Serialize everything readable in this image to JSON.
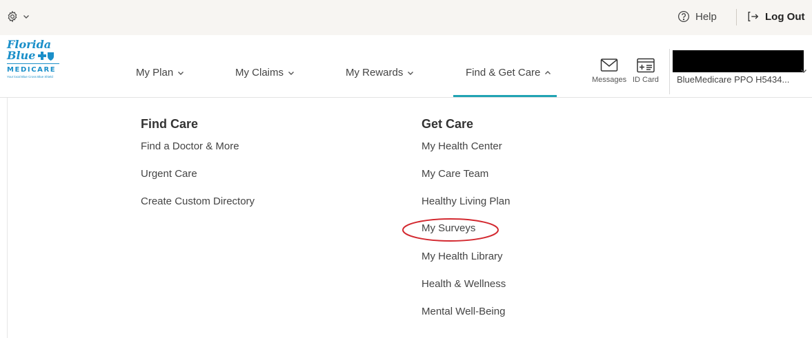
{
  "utility": {
    "settings_icon": "gear-icon",
    "help_label": "Help",
    "logout_label": "Log Out"
  },
  "logo": {
    "line1": "Florida",
    "line2": "Blue",
    "medicare": "MEDICARE",
    "tagline": "Your local Blue Cross Blue Shield"
  },
  "nav": {
    "items": [
      {
        "label": "My Plan"
      },
      {
        "label": "My Claims"
      },
      {
        "label": "My Rewards"
      },
      {
        "label": "Find & Get Care",
        "active": true
      }
    ],
    "messages_label": "Messages",
    "idcard_label": "ID Card",
    "account_plan": "BlueMedicare PPO H5434..."
  },
  "dropdown": {
    "find_care": {
      "title": "Find Care",
      "links": [
        "Find a Doctor & More",
        "Urgent Care",
        "Create Custom Directory"
      ]
    },
    "get_care": {
      "title": "Get Care",
      "links": [
        "My Health Center",
        "My Care Team",
        "Healthy Living Plan",
        "My Surveys",
        "My Health Library",
        "Health & Wellness",
        "Mental Well-Being"
      ]
    }
  },
  "colors": {
    "accent": "#20a3b3",
    "brand_blue": "#1a8fc9",
    "highlight_ring": "#d3282f",
    "utility_bg": "#f7f5f2"
  }
}
